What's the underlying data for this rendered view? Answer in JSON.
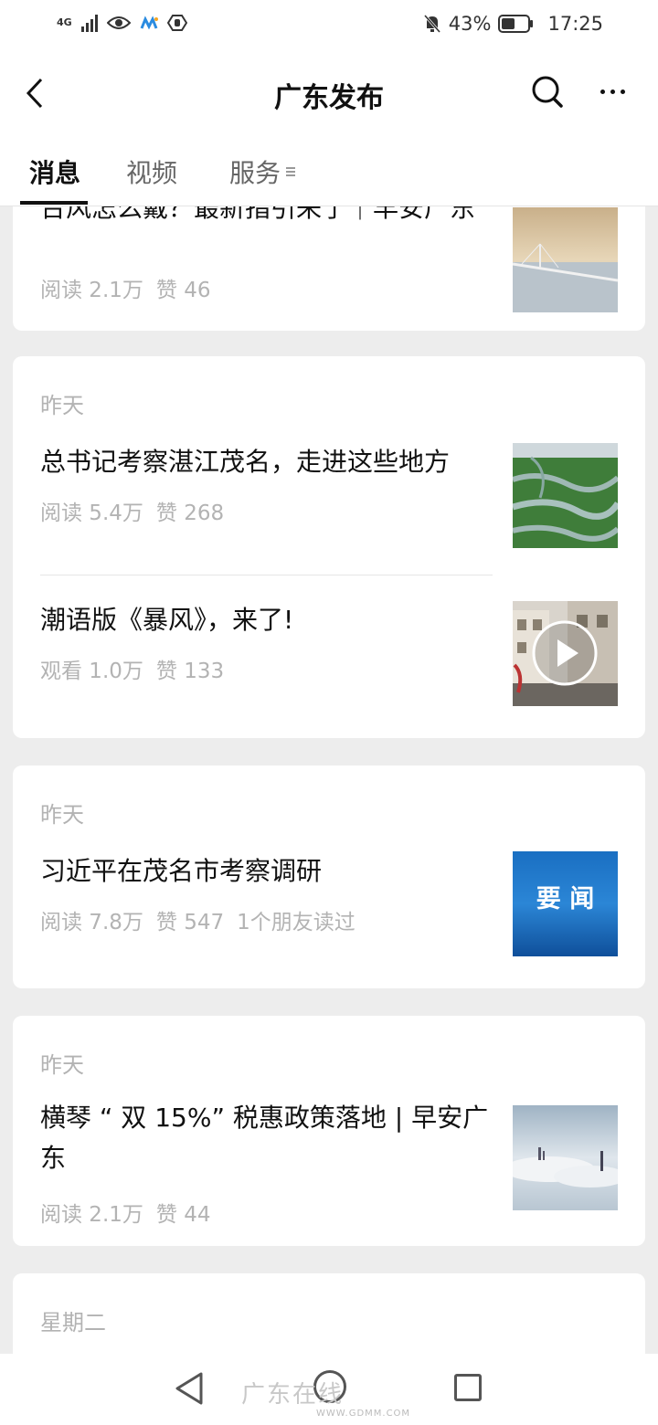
{
  "status_bar": {
    "network": "4G",
    "battery_percent": "43%",
    "time": "17:25",
    "icons": [
      "signal-icon",
      "eye-icon",
      "app-icon",
      "hand-icon",
      "mute-bell-icon",
      "battery-icon"
    ]
  },
  "header": {
    "title": "广东发布",
    "back_icon": "chevron-left-icon",
    "search_icon": "search-icon",
    "more_icon": "more-icon"
  },
  "tabs": [
    {
      "label": "消息",
      "active": true
    },
    {
      "label": "视频",
      "active": false
    },
    {
      "label": "服务",
      "active": false
    }
  ],
  "feed": {
    "cards": [
      {
        "date": "",
        "articles": [
          {
            "title": "台风怎么戴？最新指引来了｜早安广东",
            "stat1": "阅读 2.1万",
            "stat2": "赞 46",
            "stat3": ""
          }
        ]
      },
      {
        "date": "昨天",
        "articles": [
          {
            "title": "总书记考察湛江茂名，走进这些地方",
            "stat1": "阅读 5.4万",
            "stat2": "赞 268",
            "stat3": ""
          },
          {
            "title": "潮语版《暴风》，来了!",
            "stat1": "观看 1.0万",
            "stat2": "赞 133",
            "stat3": "",
            "is_video": true
          }
        ]
      },
      {
        "date": "昨天",
        "articles": [
          {
            "title": "习近平在茂名市考察调研",
            "stat1": "阅读 7.8万",
            "stat2": "赞 547",
            "stat3": "1个朋友读过",
            "thumb_text": "要 闻"
          }
        ]
      },
      {
        "date": "昨天",
        "articles": [
          {
            "title": "横琴 “ 双 15%” 税惠政策落地 | 早安广东",
            "stat1": "阅读 2.1万",
            "stat2": "赞 44",
            "stat3": ""
          }
        ]
      },
      {
        "date": "星期二",
        "articles": []
      }
    ]
  },
  "nav_bar": {
    "watermark": "广东在线",
    "watermark_url": "WWW.GDMM.COM"
  }
}
